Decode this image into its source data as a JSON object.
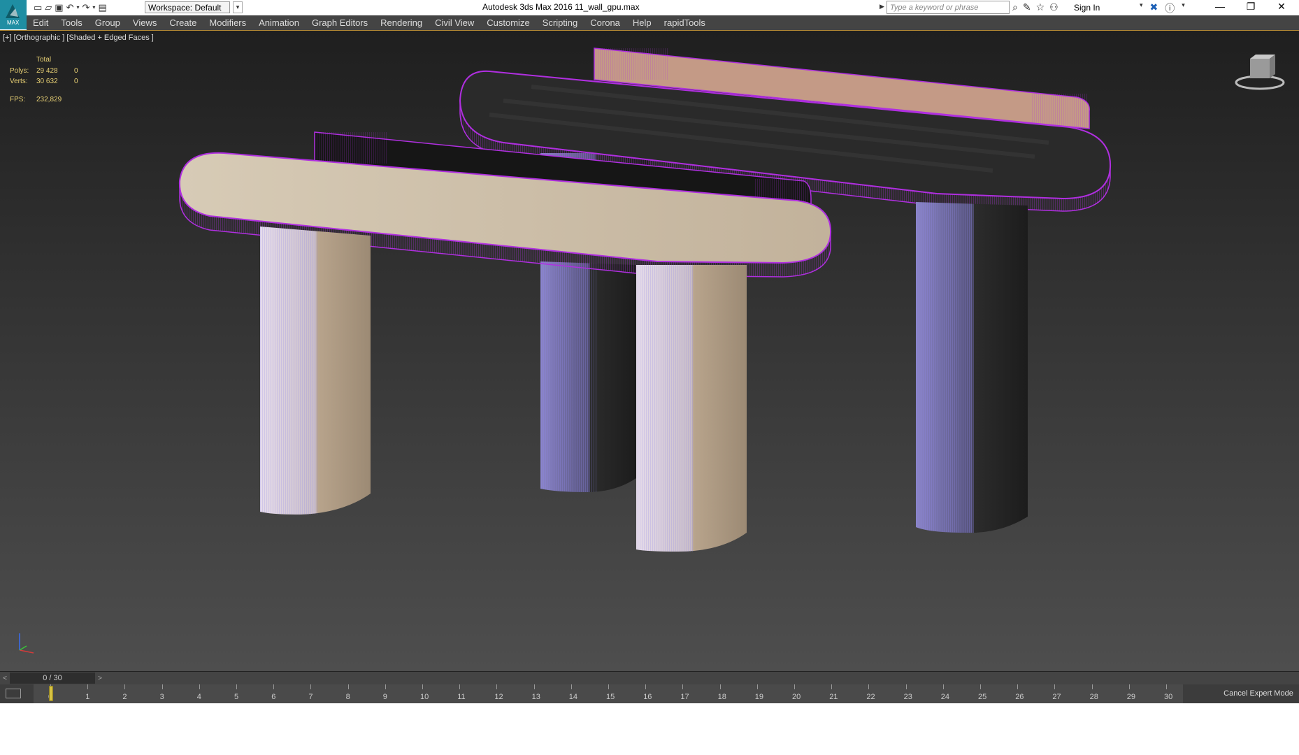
{
  "app": {
    "logo_text": "MAX",
    "workspace": "Workspace: Default",
    "title": "Autodesk 3ds Max 2016    11_wall_gpu.max",
    "search_placeholder": "Type a keyword or phrase",
    "sign_in": "Sign In"
  },
  "menu": [
    "Edit",
    "Tools",
    "Group",
    "Views",
    "Create",
    "Modifiers",
    "Animation",
    "Graph Editors",
    "Rendering",
    "Civil View",
    "Customize",
    "Scripting",
    "Corona",
    "Help",
    "rapidTools"
  ],
  "viewport": {
    "label": "[+] [Orthographic ] [Shaded + Edged Faces ]",
    "stats": {
      "header": "Total",
      "polys_label": "Polys:",
      "polys_total": "29 428",
      "polys_sel": "0",
      "verts_label": "Verts:",
      "verts_total": "30 632",
      "verts_sel": "0",
      "fps_label": "FPS:",
      "fps_value": "232,829"
    }
  },
  "timeline": {
    "frame": "0 / 30",
    "ticks": [
      "0",
      "1",
      "2",
      "3",
      "4",
      "5",
      "6",
      "7",
      "8",
      "9",
      "10",
      "11",
      "12",
      "13",
      "14",
      "15",
      "16",
      "17",
      "18",
      "19",
      "20",
      "21",
      "22",
      "23",
      "24",
      "25",
      "26",
      "27",
      "28",
      "29",
      "30"
    ],
    "cancel": "Cancel Expert Mode"
  },
  "colors": {
    "menubar": "#444444",
    "selection": "#b02fe0",
    "wireframe": "#8f86e8",
    "light_wood": "#c5b7a0",
    "dark_wood": "#2a2a2a",
    "back_panel": "#c49a86",
    "accent": "#d7c242"
  }
}
